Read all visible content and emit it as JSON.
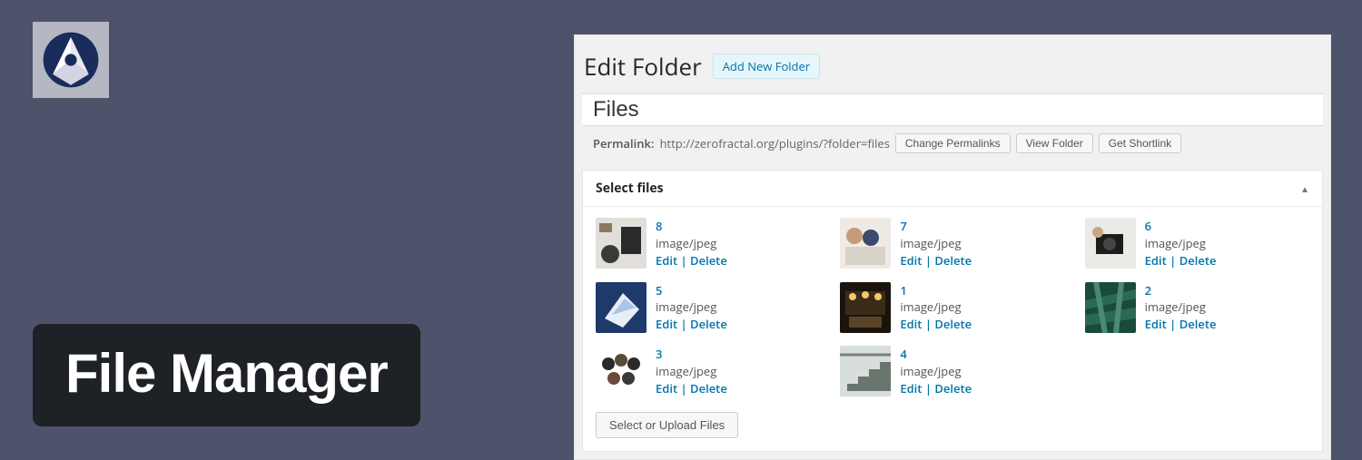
{
  "overlay_title": "File Manager",
  "panel": {
    "heading": "Edit Folder",
    "add_new_label": "Add New Folder",
    "title_value": "Files",
    "permalink_label": "Permalink:",
    "permalink_url": "http://zerofractal.org/plugins/?folder=files",
    "buttons": {
      "change_permalinks": "Change Permalinks",
      "view_folder": "View Folder",
      "get_shortlink": "Get Shortlink"
    },
    "postbox_title": "Select files",
    "select_upload_label": "Select or Upload Files",
    "edit_label": "Edit",
    "delete_label": "Delete",
    "files": [
      {
        "name": "8",
        "mime": "image/jpeg",
        "thumb": "laptop"
      },
      {
        "name": "7",
        "mime": "image/jpeg",
        "thumb": "people"
      },
      {
        "name": "6",
        "mime": "image/jpeg",
        "thumb": "camera"
      },
      {
        "name": "5",
        "mime": "image/jpeg",
        "thumb": "tablet"
      },
      {
        "name": "1",
        "mime": "image/jpeg",
        "thumb": "interior"
      },
      {
        "name": "2",
        "mime": "image/jpeg",
        "thumb": "aerial"
      },
      {
        "name": "3",
        "mime": "image/jpeg",
        "thumb": "team"
      },
      {
        "name": "4",
        "mime": "image/jpeg",
        "thumb": "stairs"
      }
    ]
  }
}
